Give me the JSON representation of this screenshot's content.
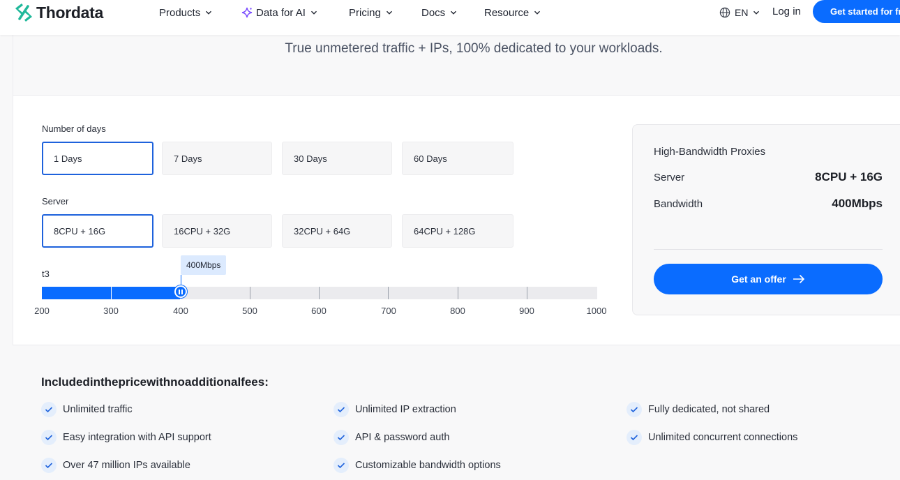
{
  "header": {
    "brand": "Thordata",
    "nav": [
      {
        "label": "Products"
      },
      {
        "label": "Data for AI"
      },
      {
        "label": "Pricing"
      },
      {
        "label": "Docs"
      },
      {
        "label": "Resource"
      }
    ],
    "language": "EN",
    "login": "Log in",
    "cta": "Get started for free"
  },
  "subtitle": "True unmetered traffic + IPs, 100% dedicated to your workloads.",
  "config": {
    "days_label": "Number of days",
    "days": [
      "1 Days",
      "7 Days",
      "30 Days",
      "60 Days"
    ],
    "days_selected": 0,
    "server_label": "Server",
    "servers": [
      "8CPU + 16G",
      "16CPU + 32G",
      "32CPU + 64G",
      "64CPU + 128G"
    ],
    "server_selected": 0,
    "bandwidth_label": "t3",
    "bandwidth_tooltip": "400Mbps",
    "bandwidth_value": 400,
    "bandwidth_scale": [
      "200",
      "300",
      "400",
      "500",
      "600",
      "700",
      "800",
      "900",
      "1000"
    ]
  },
  "summary": {
    "title": "High-Bandwidth Proxies",
    "server_label": "Server",
    "server_value": "8CPU + 16G",
    "bandwidth_label": "Bandwidth",
    "bandwidth_value": "400Mbps",
    "offer_button": "Get an offer"
  },
  "included": {
    "title": "Includedinthepricewithnoadditionalfees:",
    "features": [
      "Unlimited traffic",
      "Unlimited IP extraction",
      "Fully dedicated, not shared",
      "Easy integration with API support",
      "API & password auth",
      "Unlimited concurrent connections",
      "Over 47 million IPs available",
      "Customizable bandwidth options"
    ]
  },
  "colors": {
    "accent": "#0a6cff",
    "selected_border": "#1e62dc",
    "check_bg": "#e4eefc"
  }
}
